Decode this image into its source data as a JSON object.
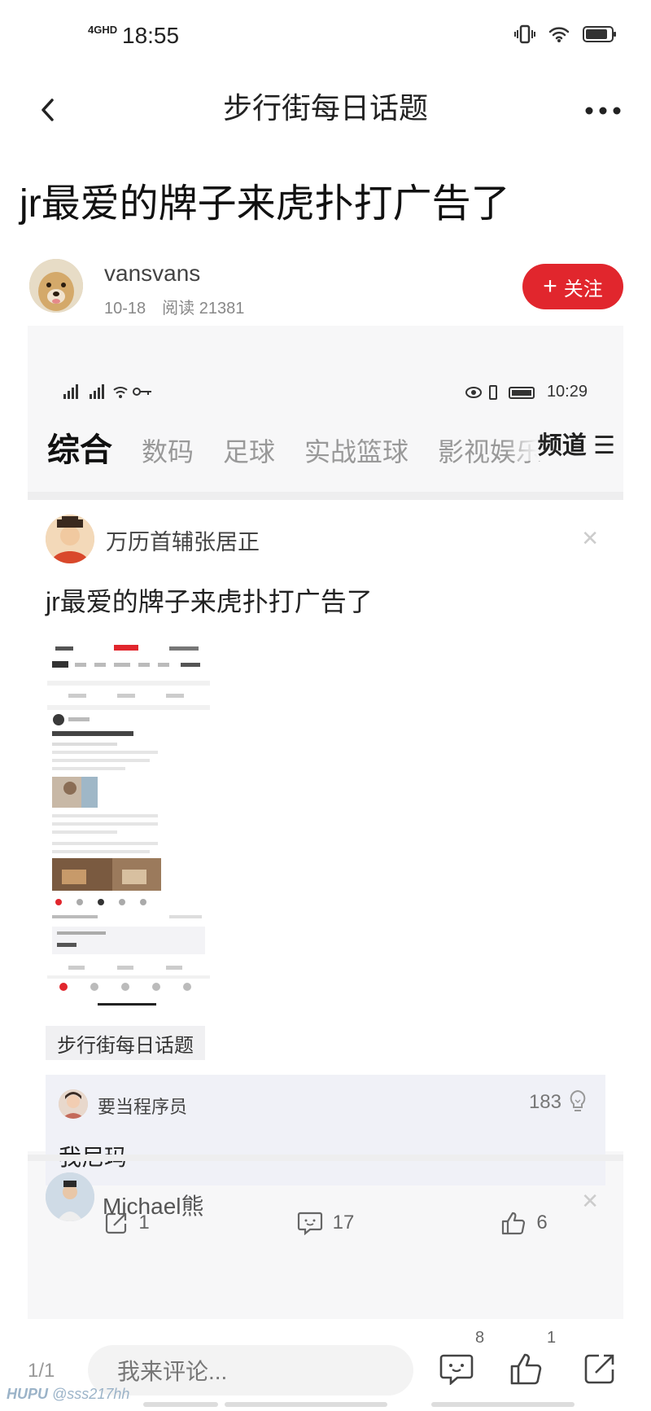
{
  "status_bar": {
    "network": "4GHD",
    "time": "18:55"
  },
  "nav": {
    "title": "步行街每日话题"
  },
  "post": {
    "title": "jr最爱的牌子来虎扑打广告了",
    "author": "vansvans",
    "date": "10-18",
    "reads": "阅读 21381",
    "follow_label": "关注"
  },
  "embedded": {
    "status_time": "10:29",
    "tabs": [
      "综合",
      "数码",
      "足球",
      "实战篮球",
      "影视娱乐"
    ],
    "channel_label": "频道",
    "card": {
      "user": "万历首辅张居正",
      "title": "jr最爱的牌子来虎扑打广告了",
      "topic": "步行街每日话题",
      "comment": {
        "user": "要当程序员",
        "likes": "183",
        "text": "我尼玛"
      },
      "actions": {
        "share": "1",
        "comments": "17",
        "likes": "6"
      }
    },
    "next_user": "Michael熊"
  },
  "bottom": {
    "page": "1/1",
    "input_placeholder": "我来评论...",
    "comment_count": "8",
    "like_count": "1",
    "watermark_brand": "HUPU",
    "watermark_user": "@sss217hh"
  },
  "colors": {
    "accent": "#e1262d",
    "comment_bg": "#f0f1f7"
  }
}
